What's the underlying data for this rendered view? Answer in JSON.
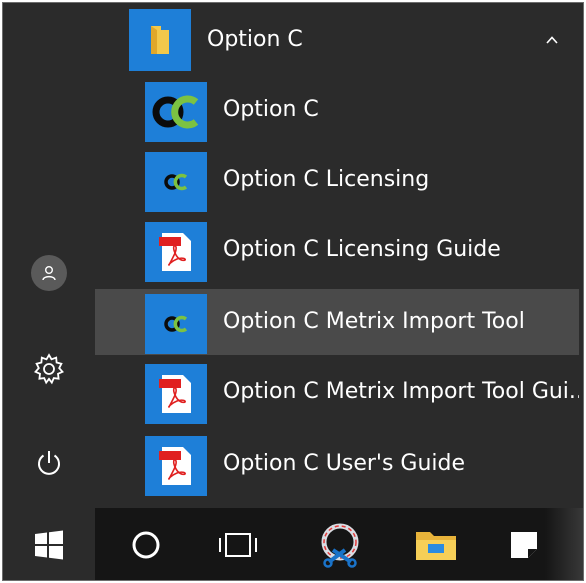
{
  "start_menu": {
    "group": {
      "label": "Option C",
      "icon": "folder-icon",
      "expanded": true
    },
    "items": [
      {
        "label": "Option C",
        "icon": "option-c-logo-icon"
      },
      {
        "label": "Option C Licensing",
        "icon": "option-c-small-logo-icon"
      },
      {
        "label": "Option C Licensing Guide",
        "icon": "pdf-icon"
      },
      {
        "label": "Option C Metrix Import Tool",
        "icon": "option-c-small-logo-icon",
        "hovered": true
      },
      {
        "label": "Option C Metrix Import Tool Gui...",
        "icon": "pdf-icon"
      },
      {
        "label": "Option C User's Guide",
        "icon": "pdf-icon"
      }
    ]
  },
  "left_rail": {
    "icons": [
      "user-icon",
      "settings-gear-icon",
      "power-icon"
    ]
  },
  "taskbar": {
    "icons": [
      "windows-start-icon",
      "cortana-circle-icon",
      "task-view-icon",
      "snipping-tool-icon",
      "file-explorer-icon",
      "sticky-notes-icon"
    ]
  },
  "colors": {
    "menu_bg": "#2b2b2b",
    "tile_accent": "#1e7fd8",
    "hover_bg": "#4a4a4a",
    "taskbar_bg": "#151515",
    "text": "#ffffff"
  }
}
